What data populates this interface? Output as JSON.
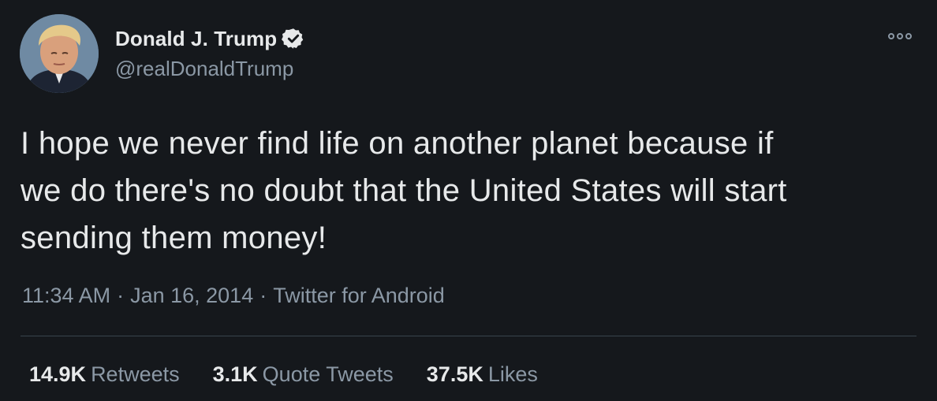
{
  "author": {
    "display_name": "Donald J. Trump",
    "handle": "@realDonaldTrump",
    "verified": true
  },
  "tweet": {
    "text_lines": [
      "I hope we never find life on another planet because if",
      "we do there's no doubt that the United States will start",
      "sending them money!"
    ],
    "time": "11:34 AM",
    "date": "Jan 16, 2014",
    "source": "Twitter for Android",
    "separator": "·"
  },
  "stats": {
    "retweets_count": "14.9K",
    "retweets_label": "Retweets",
    "quotes_count": "3.1K",
    "quotes_label": "Quote Tweets",
    "likes_count": "37.5K",
    "likes_label": "Likes"
  },
  "icons": {
    "verified": "verified-badge-icon",
    "more": "more-options-icon"
  },
  "colors": {
    "background": "#15181c",
    "primary_text": "#e7e9ea",
    "secondary_text": "#8b98a5",
    "divider": "#38444d"
  }
}
